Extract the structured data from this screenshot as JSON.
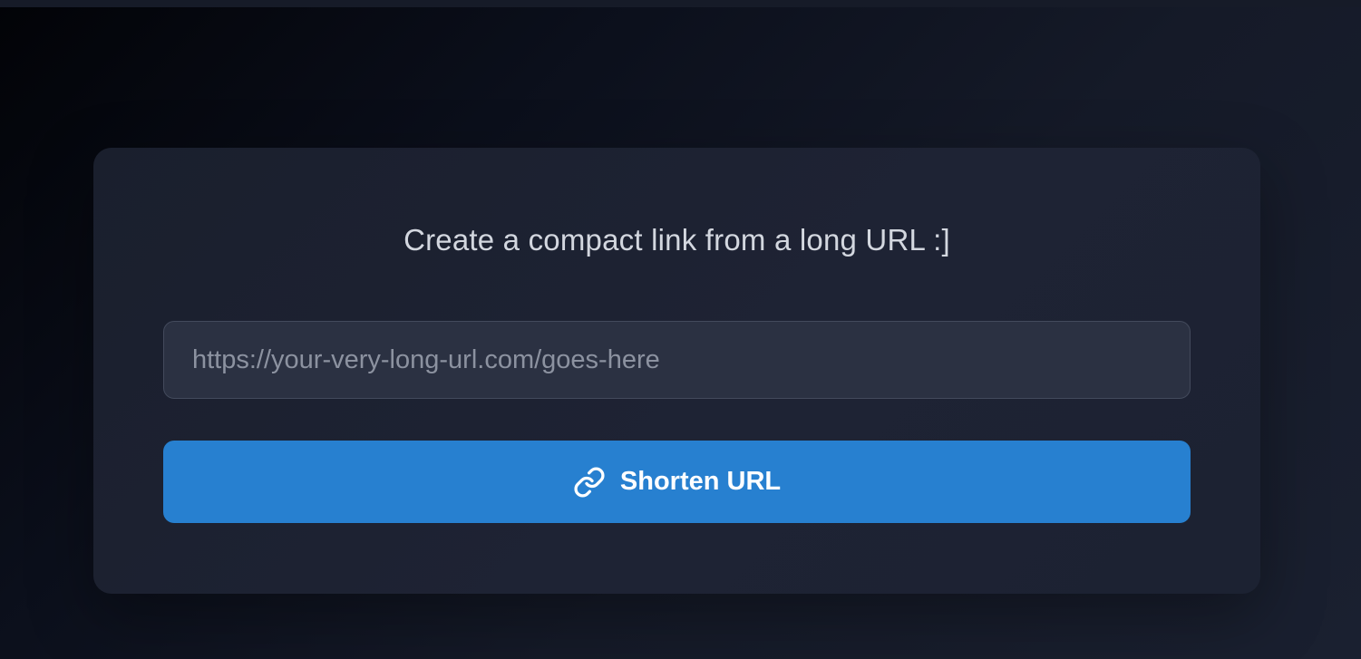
{
  "form": {
    "heading": "Create a compact link from a long URL :]",
    "url_input": {
      "value": "",
      "placeholder": "https://your-very-long-url.com/goes-here"
    },
    "submit_button": {
      "label": "Shorten URL",
      "icon": "link-icon"
    }
  },
  "colors": {
    "accent": "#2780d0",
    "card_background": "#1e2334",
    "input_background": "#2b3142",
    "heading_text": "#d3d7df",
    "placeholder_text": "#8c92a0"
  }
}
